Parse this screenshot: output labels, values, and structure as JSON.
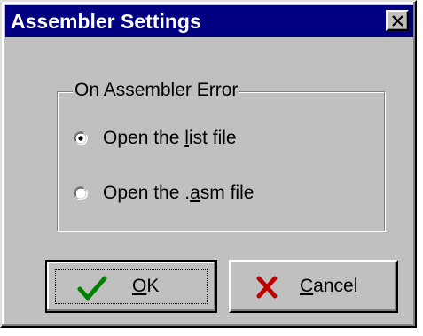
{
  "window": {
    "title": "Assembler Settings"
  },
  "group": {
    "label": "On Assembler Error",
    "options": [
      {
        "pre": "Open the ",
        "mnemonic": "l",
        "post": "ist file",
        "selected": true
      },
      {
        "pre": "Open the .",
        "mnemonic": "a",
        "post": "sm file",
        "selected": false
      }
    ]
  },
  "buttons": {
    "ok": {
      "mnemonic": "O",
      "rest": "K",
      "icon": "checkmark-icon",
      "icon_color": "#008000"
    },
    "cancel": {
      "mnemonic": "C",
      "rest": "ancel",
      "icon": "x-icon",
      "icon_color": "#c00000"
    }
  },
  "colors": {
    "titlebar": "#000080",
    "face": "#c0c0c0"
  }
}
